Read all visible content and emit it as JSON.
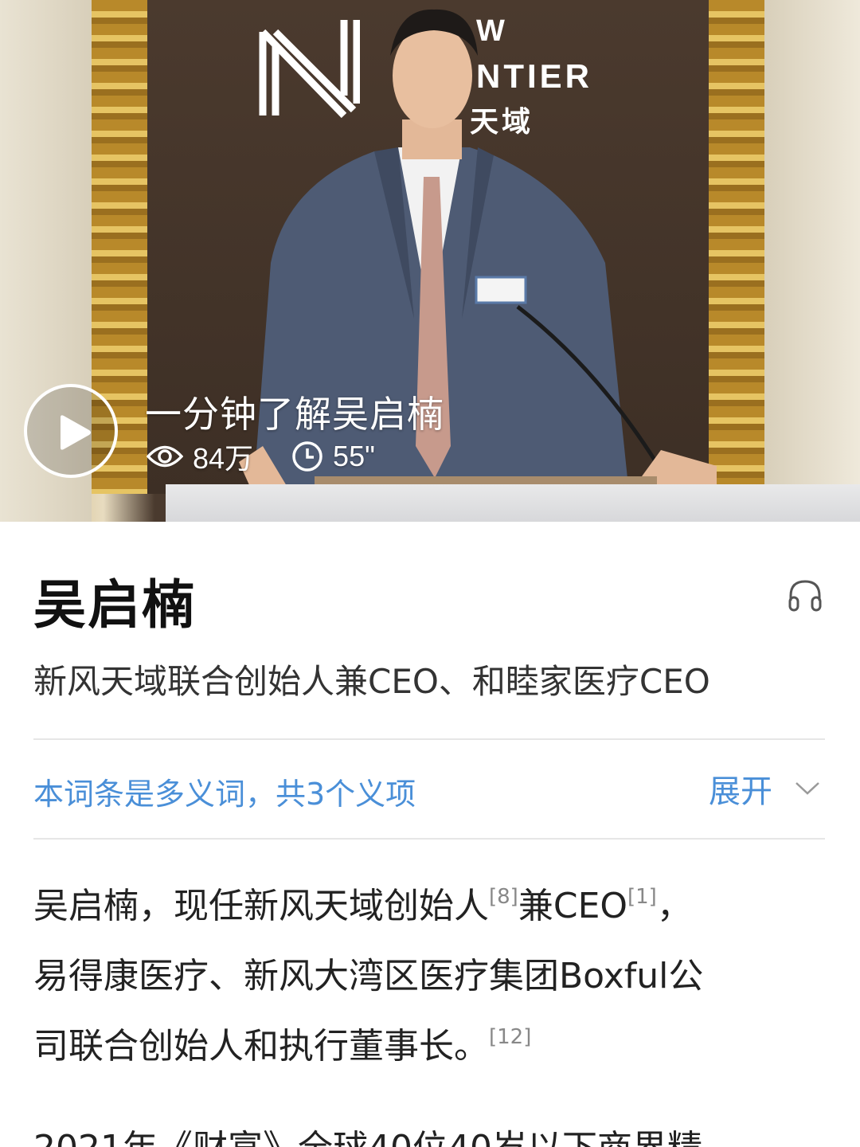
{
  "video": {
    "title": "一分钟了解吴启楠",
    "views": "84万",
    "duration": "55\"",
    "logo_line1": "W",
    "logo_line2": "NTIER",
    "logo_line3": "天域"
  },
  "entry": {
    "title": "吴启楠",
    "subtitle": "新风天域联合创始人兼CEO、和睦家医疗CEO"
  },
  "polysemy": {
    "note": "本词条是多义词，共3个义项",
    "expand_label": "展开"
  },
  "summary": {
    "line1_a": "吴启楠，现任新风天域创始人",
    "ref1": "[8]",
    "line1_b": "兼CEO",
    "ref2": "[1]",
    "line1_c": "，",
    "line2": "易得康医疗、新风大湾区医疗集团Boxful公",
    "line3": "司联合创始人和执行董事长。",
    "ref3": "[12]"
  },
  "next_paragraph": "2021年《财富》全球40位40岁以下商界精",
  "colors": {
    "link": "#4a8fd8",
    "text": "#222222",
    "divider": "#e6e6e6"
  }
}
